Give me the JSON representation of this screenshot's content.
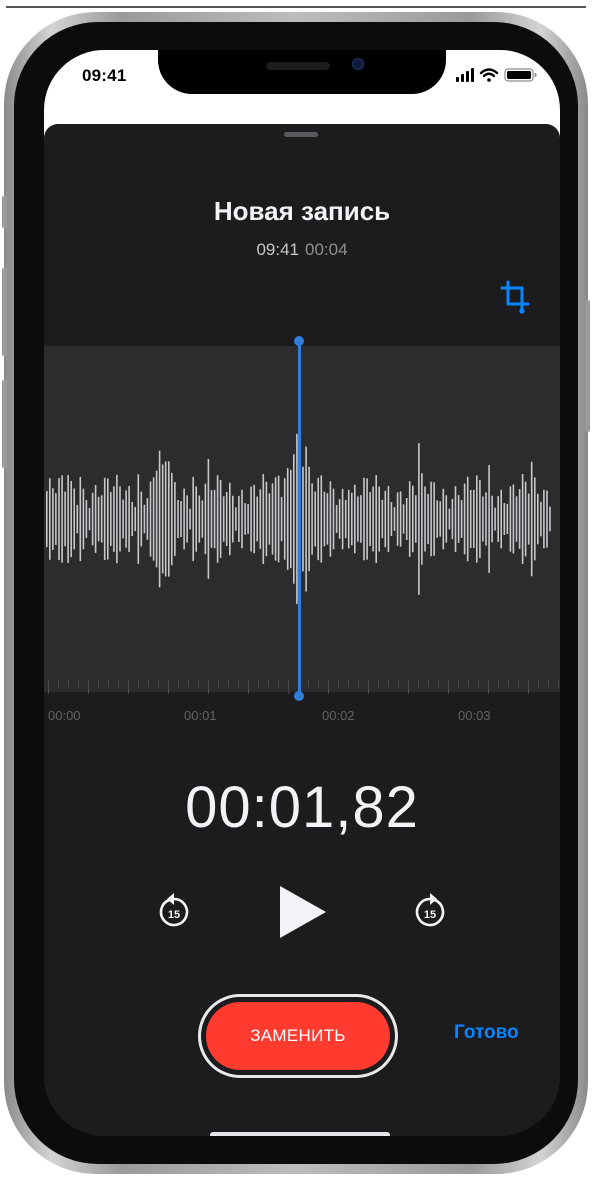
{
  "status_bar": {
    "time": "09:41"
  },
  "recording": {
    "title": "Новая запись",
    "time": "09:41",
    "duration": "00:04"
  },
  "timeline": {
    "labels": [
      "00:00",
      "00:01",
      "00:02",
      "00:03"
    ]
  },
  "playback": {
    "current_time": "00:01,82",
    "skip_back_seconds": "15",
    "skip_forward_seconds": "15"
  },
  "actions": {
    "replace_label": "ЗАМЕНИТЬ",
    "done_label": "Готово"
  },
  "colors": {
    "accent": "#0a84ff",
    "record_red": "#ff3b30",
    "sheet_background": "#1c1c1e",
    "waveform_band": "#2c2c2e"
  },
  "icons": [
    "crop-icon",
    "skip-back-15-icon",
    "play-icon",
    "skip-forward-15-icon",
    "signal-icon",
    "wifi-icon",
    "battery-icon"
  ]
}
